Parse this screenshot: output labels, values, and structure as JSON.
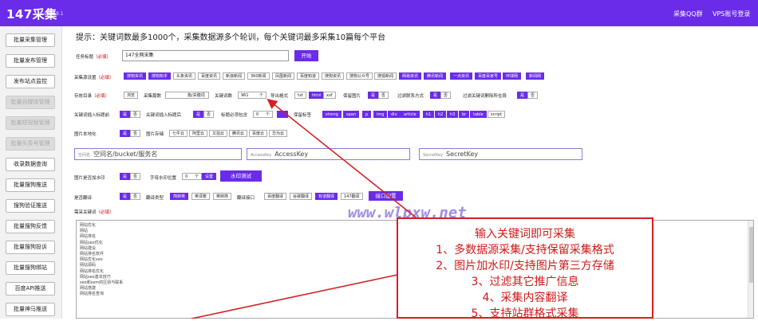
{
  "header": {
    "logo": "147采集",
    "version": "v1.2.9.1",
    "link_qq": "采集QQ群",
    "link_vps": "VPS账号登录"
  },
  "sidebar": {
    "items": [
      {
        "label": "批量采集管理",
        "disabled": false
      },
      {
        "label": "批量发布管理",
        "disabled": false
      },
      {
        "label": "发布站点监控",
        "disabled": false
      },
      {
        "label": "批量自媒体管理",
        "disabled": true
      },
      {
        "label": "批量短视频管理",
        "disabled": true
      },
      {
        "label": "批量头条号管理",
        "disabled": true
      },
      {
        "label": "收录数据查询",
        "disabled": false
      },
      {
        "label": "批量搜狗推送",
        "disabled": false
      },
      {
        "label": "搜狗验证推送",
        "disabled": false
      },
      {
        "label": "批量搜狗反馈",
        "disabled": false
      },
      {
        "label": "批量搜狗投诉",
        "disabled": false
      },
      {
        "label": "批量搜狗绑站",
        "disabled": false
      },
      {
        "label": "百度API推送",
        "disabled": false
      },
      {
        "label": "批量神马推送",
        "disabled": false
      }
    ]
  },
  "tip": "提示：关键词数最多1000个，采集数据源多个轮训，每个关键词最多采集10篇每个平台",
  "task": {
    "label": "任务标题",
    "required": "（必填）",
    "value": "147全网采集",
    "start": "开始"
  },
  "sources": {
    "label": "采集源设置",
    "required": "（必填）",
    "items": [
      "搜狗资讯",
      "搜狗知乎",
      "头条资讯",
      "百度资讯",
      "新浪新闻",
      "360新闻",
      "凤凰新闻",
      "百度知道",
      "搜狗资讯",
      "搜狗公众号",
      "搜狐新闻",
      "网易资讯",
      "腾讯新闻",
      "一点资讯",
      "百度百家号",
      "环球网",
      "新闻网"
    ]
  },
  "row3": {
    "label": "存放目录",
    "required": "（必填）",
    "browse": "浏览",
    "count_label": "采集篇数",
    "count_unit": "篇/关键词",
    "kwcount_label": "关键词数",
    "kwcount_value": "961",
    "kwcount_unit": "个",
    "format_label": "导出格式",
    "formats": [
      "txt",
      "html",
      "xxf"
    ],
    "keepimg_label": "保留图片",
    "yes": "是",
    "no": "否",
    "filter_label": "过滤联系方式",
    "filterkw_label": "过滤关键词删除所在段"
  },
  "row4": {
    "insert_title_label": "关键词插入标题前",
    "insert_body_label": "关键词插入标题后",
    "bodyhas_label": "标题必须包含",
    "bodyhas_value": "0",
    "bodyhas_unit": "个",
    "keeptag_label": "保留标签",
    "tags": [
      "strong",
      "span",
      "p",
      "img",
      "div",
      "article",
      "h1",
      "h2",
      "h3",
      "br",
      "table",
      "script"
    ]
  },
  "row5": {
    "local_label": "图片本地化",
    "storage_label": "图片存储",
    "storages": [
      "七牛云",
      "阿里云",
      "又拍云",
      "腾讯云",
      "百度云",
      "华为云"
    ]
  },
  "row6": {
    "space_label": "空间名",
    "space_ph": "空间名/bucket/服务名",
    "ak_label": "AccessKey",
    "ak_ph": "AccessKey",
    "sk_label": "SecretKey",
    "sk_ph": "SecretKey"
  },
  "row7": {
    "label": "图片是否加水印",
    "pos_label": "字母水印位置",
    "pos_value": "0",
    "pos_unit": "个",
    "set": "设置",
    "test": "水印测试"
  },
  "row8": {
    "label": "是否翻译",
    "type_label": "翻译类型",
    "types": [
      "简转英",
      "英译繁",
      "英转简"
    ],
    "api_label": "翻译接口",
    "apis": [
      "百度翻译",
      "谷歌翻译",
      "有道翻译",
      "147翻译"
    ],
    "config": "接口配置"
  },
  "kwlabel": "需采关键词",
  "kwrequired": "（必填）",
  "keywords": [
    "网站优化",
    "网站",
    "网站排名",
    "网站seo优化",
    "网站建设",
    "网站排名软件",
    "网站优化seo",
    "网站源码",
    "网站排名优化",
    "网站seo基本技巧",
    "seo和sem的区别与联系",
    "网站搭建",
    "网站排名查询"
  ],
  "watermark": "www.wlpxw.net",
  "promo": [
    "输入关键词即可采集",
    "1、多数据源采集/支持保留采集格式",
    "2、图片加水印/支持图片第三方存储",
    "3、过滤其它推广信息",
    "4、采集内容翻译",
    "5、支持站群格式采集"
  ],
  "colors": {
    "accent": "#6a2ce8",
    "promo_red": "#d01818"
  }
}
